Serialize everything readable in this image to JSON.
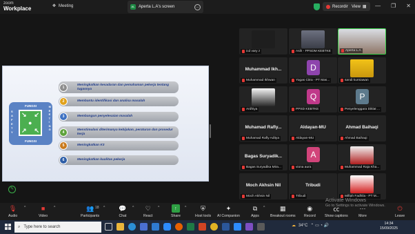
{
  "topbar": {
    "logo_line1": "zoom",
    "logo_line2": "Workplace",
    "meeting_label": "Meeting",
    "share_title": "Aperta L.A's screen",
    "share_initials": "AL",
    "recording_label": "Recording",
    "view_label": "View",
    "accent_green": "#27ae60",
    "record_red": "#e53935"
  },
  "slide": {
    "fungsi_top": "FUNGSI",
    "fungsi_bottom": "FUNGSI",
    "safety_letters": [
      "S",
      "A",
      "F",
      "E",
      "T",
      "Y"
    ],
    "meeting_letters": [
      "M",
      "E",
      "E",
      "T",
      "I",
      "N",
      "G"
    ],
    "items": [
      {
        "num": "1",
        "text": "Meningkatkan kesadaran dan pemahaman pekerja tentang tugasnya",
        "color": "#8d8d8d"
      },
      {
        "num": "2",
        "text": "Membantu identifikasi dan analisa masalah",
        "color": "#e0a11b"
      },
      {
        "num": "3",
        "text": "Membangun penyelesaian masalah",
        "color": "#3f72c2"
      },
      {
        "num": "4",
        "text": "Menstimulasi diterimanya kebijakan, peraturan dan prosedur kerja",
        "color": "#5ea33d"
      },
      {
        "num": "5",
        "text": "Meningkatkan K3",
        "color": "#c97a1c"
      },
      {
        "num": "6",
        "text": "Meningkatkan kualitas pekerja",
        "color": "#2f5fa8"
      }
    ]
  },
  "gallery": {
    "tiles": [
      {
        "label": "icd vary z",
        "big": "",
        "avatar": "",
        "kind": "video-dark"
      },
      {
        "label": "Asih - PPSDM KEBTKE",
        "big": "",
        "avatar": "",
        "kind": "video-room"
      },
      {
        "label": "Aperta L.A",
        "big": "",
        "avatar": "",
        "kind": "video-person"
      },
      {
        "label": "Muhammad Ikhwan",
        "big": "Muhammad Ikh...",
        "avatar": "",
        "kind": "name"
      },
      {
        "label": "Yogas Citra - PT Mas...",
        "big": "",
        "avatar": "D",
        "avatar_color": "#8e44ad",
        "kind": "avatar"
      },
      {
        "label": "sandi kurniawan",
        "big": "",
        "avatar": "",
        "kind": "video-yellow"
      },
      {
        "label": "Ardhiya",
        "big": "",
        "avatar": "",
        "kind": "video-portrait"
      },
      {
        "label": "PPSD KEBTKE",
        "big": "",
        "avatar": "Q",
        "avatar_color": "#c0398a",
        "kind": "avatar"
      },
      {
        "label": "Penyelenggara Diklat ...",
        "big": "",
        "avatar": "P",
        "avatar_color": "#5d7a8c",
        "kind": "avatar"
      },
      {
        "label": "Muhamad Rafly Aditya",
        "big": "Muhamad Rafly...",
        "avatar": "",
        "kind": "name"
      },
      {
        "label": "Aldayan-MU",
        "big": "Aldayan-MU",
        "avatar": "",
        "kind": "name"
      },
      {
        "label": "Ahmad Baihaqi",
        "big": "Ahmad Baihaqi",
        "avatar": "",
        "kind": "name"
      },
      {
        "label": "Bagas Suryadika Mira...",
        "big": "Bagas Suryadik...",
        "avatar": "",
        "kind": "name"
      },
      {
        "label": "viona aura",
        "big": "",
        "avatar": "A",
        "avatar_color": "#d2447a",
        "kind": "avatar"
      },
      {
        "label": "Muhammad Raja Kha...",
        "big": "",
        "avatar": "",
        "kind": "video-red"
      },
      {
        "label": "Moch Akhsin Nil",
        "big": "Moch Akhsin Nil",
        "avatar": "",
        "kind": "name"
      },
      {
        "label": "Tribudi",
        "big": "Tribudi",
        "avatar": "",
        "kind": "name"
      },
      {
        "label": "Miftah Fadhila - PT M...",
        "big": "",
        "avatar": "",
        "kind": "video-logo"
      }
    ]
  },
  "toolbar": {
    "audio": "Audio",
    "video": "Video",
    "participants": "Participants",
    "participants_count": "18",
    "chat": "Chat",
    "react": "React",
    "share": "Share",
    "host_tools": "Host tools",
    "ai_companion": "AI Companion",
    "apps": "Apps",
    "breakout": "Breakout rooms",
    "record": "Record",
    "captions": "Show captions",
    "more": "More",
    "leave": "Leave"
  },
  "watermark": {
    "line1": "Activate Windows",
    "line2": "Go to Settings to activate Windows."
  },
  "taskbar": {
    "search_placeholder": "Type here to search",
    "temperature": "34°C",
    "time": "14:34",
    "date": "15/09/2025"
  }
}
